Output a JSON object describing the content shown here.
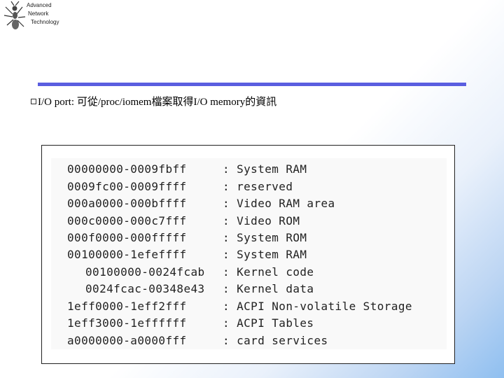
{
  "logo": {
    "lines": [
      "Advanced",
      "Network",
      "Technology"
    ]
  },
  "bullet": {
    "text": "I/O port: 可從/proc/iomem檔案取得I/O memory的資訊"
  },
  "iomem": {
    "rows": [
      {
        "range": "00000000-0009fbff",
        "sep": ":",
        "desc": "System RAM"
      },
      {
        "range": "0009fc00-0009ffff",
        "sep": ":",
        "desc": "reserved"
      },
      {
        "range": "000a0000-000bffff",
        "sep": ":",
        "desc": "Video RAM area"
      },
      {
        "range": "000c0000-000c7fff",
        "sep": ":",
        "desc": "Video ROM"
      },
      {
        "range": "000f0000-000fffff",
        "sep": ":",
        "desc": "System ROM"
      },
      {
        "range": "00100000-1efeffff",
        "sep": ":",
        "desc": "System RAM"
      },
      {
        "range": "00100000-0024fcab",
        "sep": ":",
        "desc": "Kernel code"
      },
      {
        "range": "0024fcac-00348e43",
        "sep": ":",
        "desc": "Kernel data"
      },
      {
        "range": "1eff0000-1eff2fff",
        "sep": ":",
        "desc": "ACPI Non-volatile Storage"
      },
      {
        "range": "1eff3000-1effffff",
        "sep": ":",
        "desc": "ACPI Tables"
      },
      {
        "range": "a0000000-a0000fff",
        "sep": ":",
        "desc": "card services"
      }
    ]
  }
}
